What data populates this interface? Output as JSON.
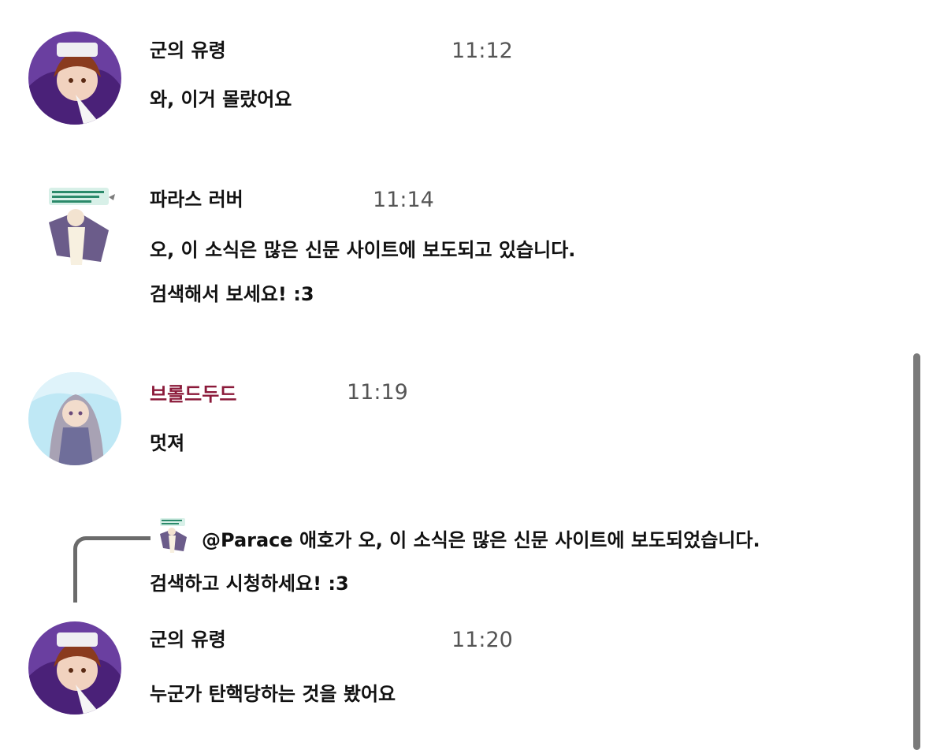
{
  "messages": [
    {
      "author": "군의 유령",
      "time": "11:12",
      "lines": [
        "와, 이거 몰랐어요"
      ],
      "avatar_icon": "purple-hood-character-avatar",
      "author_color": "#111111"
    },
    {
      "author": "파라스 러버",
      "time": "11:14",
      "lines": [
        "오, 이 소식은 많은 신문 사이트에 보도되고 있습니다.",
        "검색해서 보세요! :3"
      ],
      "avatar_icon": "caped-character-sticker-avatar",
      "author_color": "#111111"
    },
    {
      "author": "브롤드두드",
      "time": "11:19",
      "lines": [
        "멋져"
      ],
      "avatar_icon": "silver-hair-character-avatar",
      "author_color": "#8b1a3a"
    },
    {
      "author": "군의 유령",
      "time": "11:20",
      "lines": [
        "누군가 탄핵당하는 것을 봤어요"
      ],
      "avatar_icon": "purple-hood-character-avatar",
      "author_color": "#111111"
    }
  ],
  "reply": {
    "line1": "@Parace 애호가 오, 이 소식은 많은 신문 사이트에 보도되었습니다.",
    "line2": "검색하고 시청하세요! :3",
    "thumb_icon": "caped-character-sticker-thumbnail"
  }
}
